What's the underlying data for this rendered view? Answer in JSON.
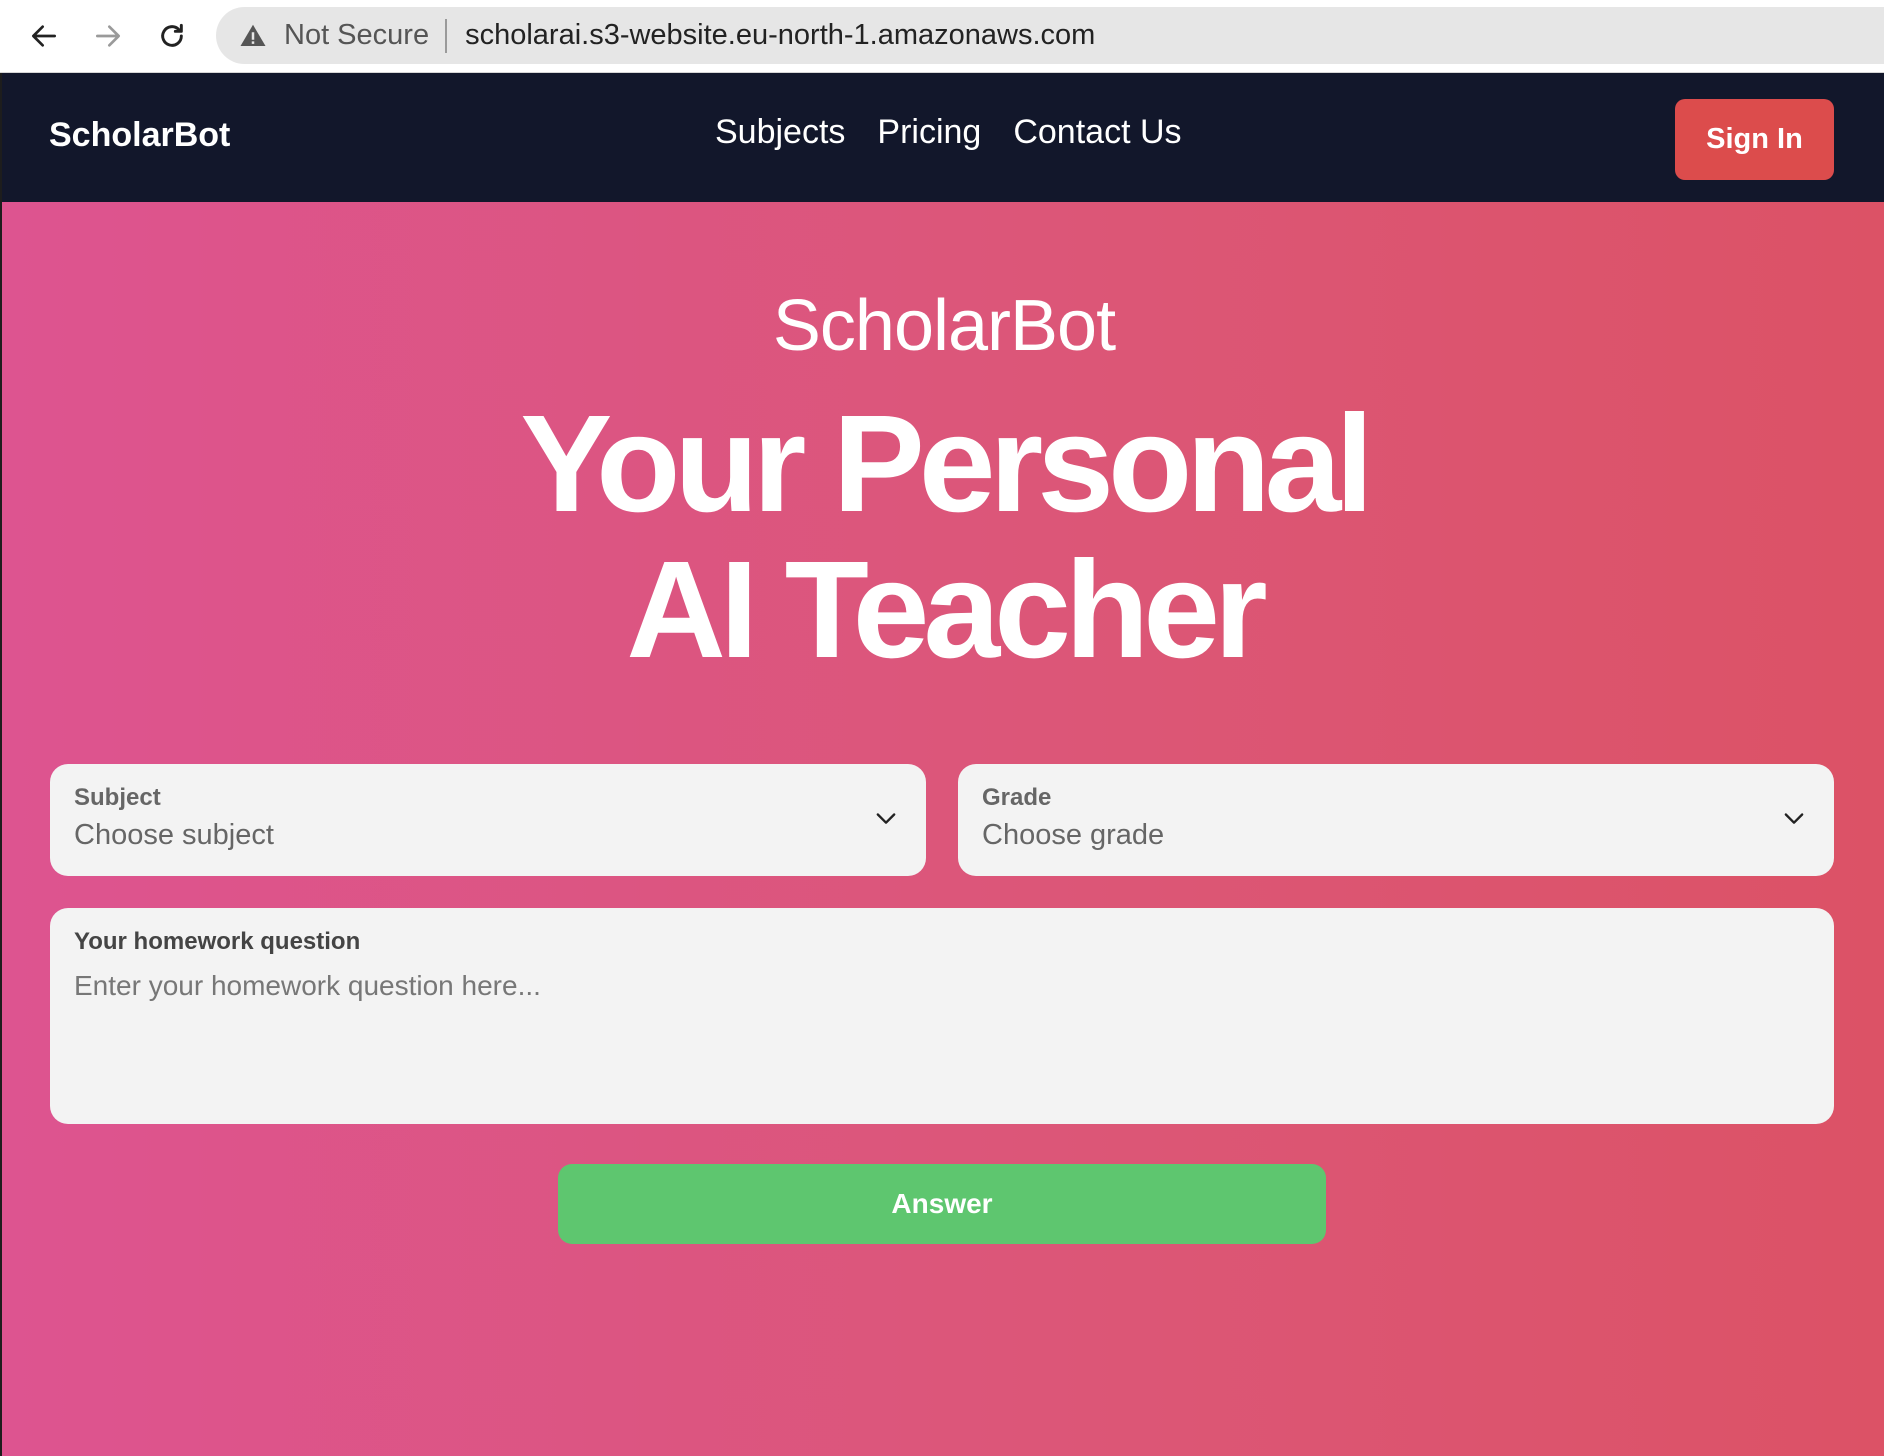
{
  "browser": {
    "security_label": "Not Secure",
    "url": "scholarai.s3-website.eu-north-1.amazonaws.com"
  },
  "navbar": {
    "brand": "ScholarBot",
    "links": [
      "Subjects",
      "Pricing",
      "Contact Us"
    ],
    "signin_label": "Sign In"
  },
  "hero": {
    "subtitle": "ScholarBot",
    "title_line1": "Your Personal",
    "title_line2": "AI Teacher"
  },
  "form": {
    "subject": {
      "label": "Subject",
      "value": "Choose subject"
    },
    "grade": {
      "label": "Grade",
      "value": "Choose grade"
    },
    "question": {
      "label": "Your homework question",
      "placeholder": "Enter your homework question here..."
    },
    "submit_label": "Answer"
  },
  "colors": {
    "navbar_bg": "#12172b",
    "signin_bg": "#dc4c4c",
    "hero_gradient_start": "#dd5490",
    "hero_gradient_end": "#dc5266",
    "answer_bg": "#5ec66f"
  },
  "icons": {
    "back": "arrow-left-icon",
    "forward": "arrow-right-icon",
    "reload": "reload-icon",
    "warning": "warning-triangle-icon",
    "dropdown": "chevron-down-icon"
  }
}
